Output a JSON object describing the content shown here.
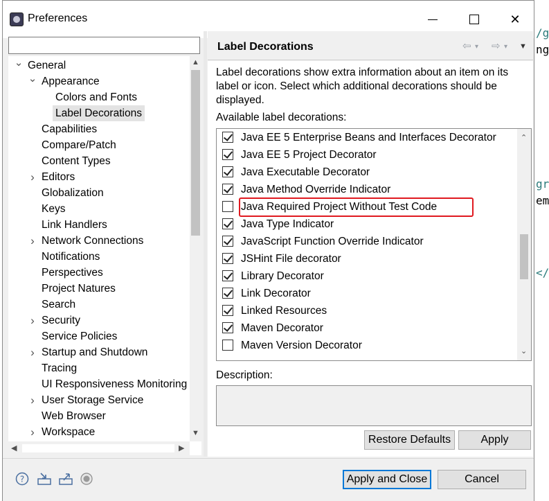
{
  "window": {
    "title": "Preferences"
  },
  "background_editor": {
    "lines": [
      "/g",
      "ng",
      "gr",
      "em",
      "</"
    ]
  },
  "filter": {
    "value": ""
  },
  "tree": {
    "items": [
      {
        "label": "General",
        "level": 0,
        "twisty": "expanded"
      },
      {
        "label": "Appearance",
        "level": 1,
        "twisty": "expanded"
      },
      {
        "label": "Colors and Fonts",
        "level": 2,
        "twisty": "none"
      },
      {
        "label": "Label Decorations",
        "level": 2,
        "twisty": "none",
        "selected": true
      },
      {
        "label": "Capabilities",
        "level": 1,
        "twisty": "none"
      },
      {
        "label": "Compare/Patch",
        "level": 1,
        "twisty": "none"
      },
      {
        "label": "Content Types",
        "level": 1,
        "twisty": "none"
      },
      {
        "label": "Editors",
        "level": 1,
        "twisty": "collapsed"
      },
      {
        "label": "Globalization",
        "level": 1,
        "twisty": "none"
      },
      {
        "label": "Keys",
        "level": 1,
        "twisty": "none"
      },
      {
        "label": "Link Handlers",
        "level": 1,
        "twisty": "none"
      },
      {
        "label": "Network Connections",
        "level": 1,
        "twisty": "collapsed"
      },
      {
        "label": "Notifications",
        "level": 1,
        "twisty": "none"
      },
      {
        "label": "Perspectives",
        "level": 1,
        "twisty": "none"
      },
      {
        "label": "Project Natures",
        "level": 1,
        "twisty": "none"
      },
      {
        "label": "Search",
        "level": 1,
        "twisty": "none"
      },
      {
        "label": "Security",
        "level": 1,
        "twisty": "collapsed"
      },
      {
        "label": "Service Policies",
        "level": 1,
        "twisty": "none"
      },
      {
        "label": "Startup and Shutdown",
        "level": 1,
        "twisty": "collapsed"
      },
      {
        "label": "Tracing",
        "level": 1,
        "twisty": "none"
      },
      {
        "label": "UI Responsiveness Monitoring",
        "level": 1,
        "twisty": "none"
      },
      {
        "label": "User Storage Service",
        "level": 1,
        "twisty": "collapsed"
      },
      {
        "label": "Web Browser",
        "level": 1,
        "twisty": "none"
      },
      {
        "label": "Workspace",
        "level": 1,
        "twisty": "collapsed"
      }
    ]
  },
  "page": {
    "title": "Label Decorations",
    "intro": "Label decorations show extra information about an item on its label or icon. Select which additional decorations should be displayed.",
    "available_label": "Available label decorations:",
    "decorations": [
      {
        "label": "Java EE 5 Enterprise Beans and Interfaces Decorator",
        "checked": true
      },
      {
        "label": "Java EE 5 Project Decorator",
        "checked": true
      },
      {
        "label": "Java Executable Decorator",
        "checked": true
      },
      {
        "label": "Java Method Override Indicator",
        "checked": true
      },
      {
        "label": "Java Required Project Without Test Code",
        "checked": false,
        "highlighted": true
      },
      {
        "label": "Java Type Indicator",
        "checked": true
      },
      {
        "label": "JavaScript Function Override Indicator",
        "checked": true
      },
      {
        "label": "JSHint File decorator",
        "checked": true
      },
      {
        "label": "Library Decorator",
        "checked": true
      },
      {
        "label": "Link Decorator",
        "checked": true
      },
      {
        "label": "Linked Resources",
        "checked": true
      },
      {
        "label": "Maven Decorator",
        "checked": true
      },
      {
        "label": "Maven Version Decorator",
        "checked": false
      }
    ],
    "description_label": "Description:",
    "description_value": "",
    "restore_defaults": "Restore Defaults",
    "apply": "Apply"
  },
  "footer": {
    "apply_and_close": "Apply and Close",
    "cancel": "Cancel",
    "icons": [
      "help-icon",
      "import-icon",
      "export-icon",
      "record-icon"
    ]
  },
  "colors": {
    "highlight_box": "#e0191f",
    "default_button_border": "#0078d7"
  }
}
